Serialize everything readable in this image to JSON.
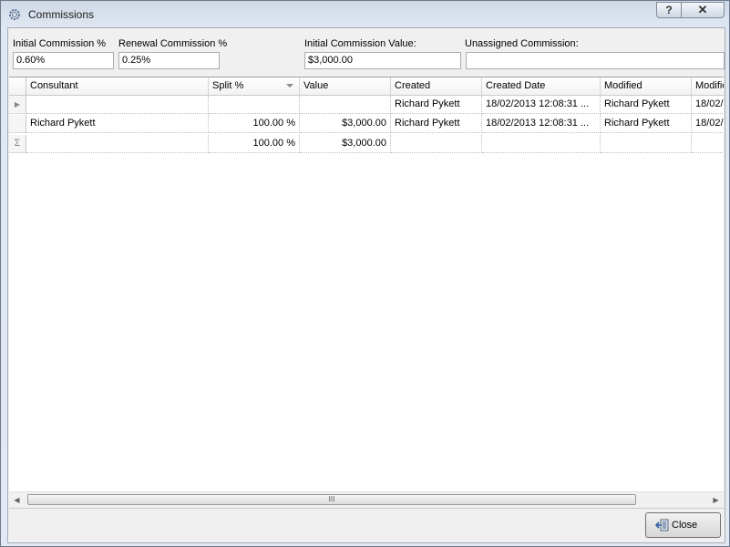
{
  "window": {
    "title": "Commissions",
    "help_label": "?",
    "close_label": "✕"
  },
  "fields": {
    "initial_pct_label": "Initial Commission %",
    "initial_pct_value": "0.60%",
    "renewal_pct_label": "Renewal Commission %",
    "renewal_pct_value": "0.25%",
    "initial_value_label": "Initial Commission Value:",
    "initial_value_value": "$3,000.00",
    "unassigned_label": "Unassigned Commission:",
    "unassigned_value": ""
  },
  "grid": {
    "columns": [
      "Consultant",
      "Split %",
      "Value",
      "Created",
      "Created Date",
      "Modified",
      "Modifie"
    ],
    "rows": [
      {
        "indicator": "▶",
        "consultant": "",
        "split": "",
        "value": "",
        "created": "Richard Pykett",
        "created_date": "18/02/2013 12:08:31 ...",
        "modified": "Richard Pykett",
        "modified_date": "18/02/"
      },
      {
        "indicator": "",
        "consultant": "Richard Pykett",
        "split": "100.00 %",
        "value": "$3,000.00",
        "created": "Richard Pykett",
        "created_date": "18/02/2013 12:08:31 ...",
        "modified": "Richard Pykett",
        "modified_date": "18/02/"
      }
    ],
    "summary": {
      "indicator": "Σ",
      "split": "100.00 %",
      "value": "$3,000.00"
    }
  },
  "scrollbar": {
    "left": "◀",
    "right": "▶",
    "thumb": "III"
  },
  "footer": {
    "close_button": "Close"
  }
}
